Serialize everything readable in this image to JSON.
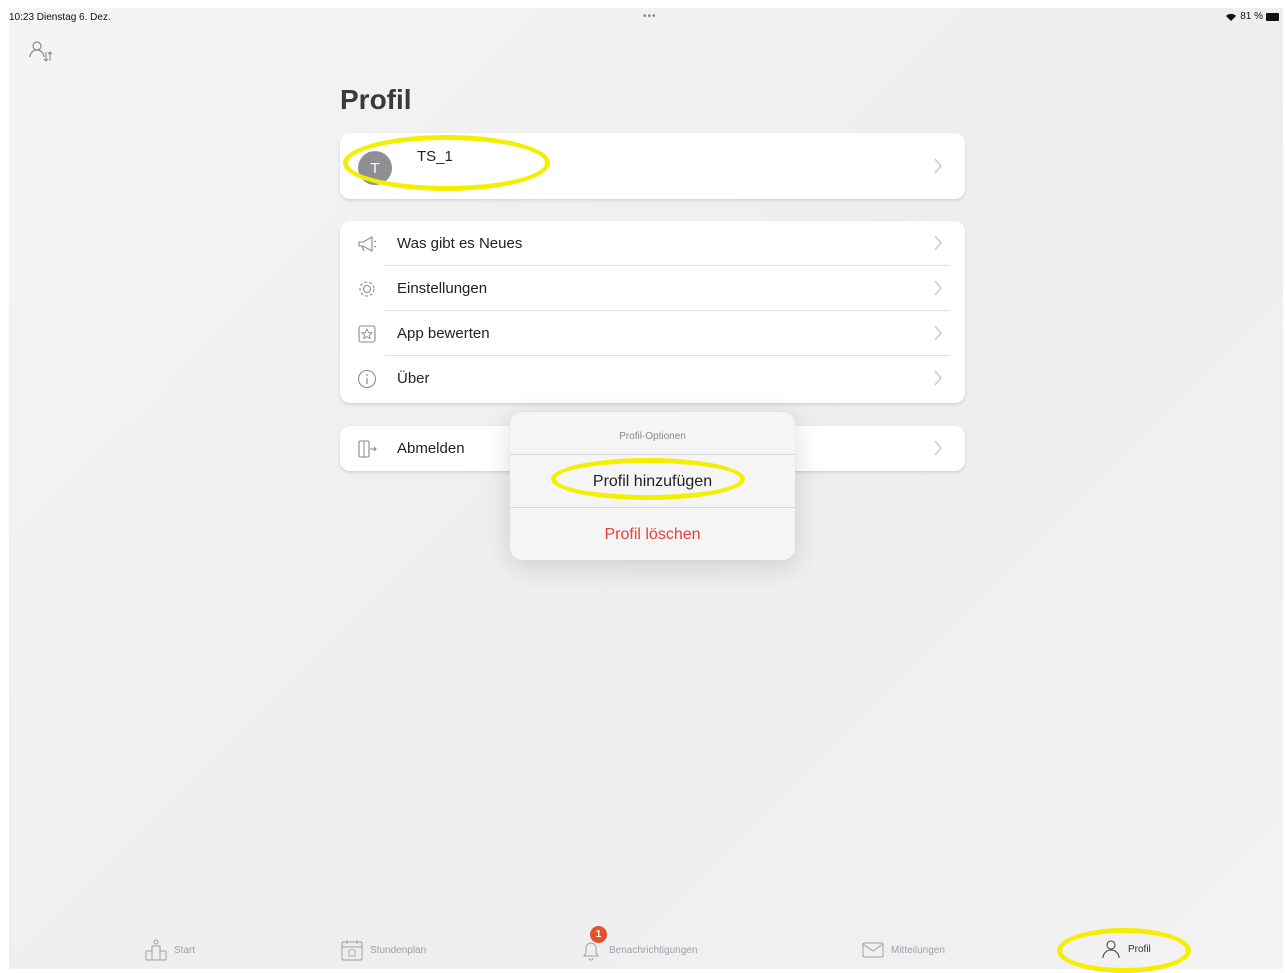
{
  "status_bar": {
    "time_date": "10:23  Dienstag 6. Dez.",
    "dots": "•••",
    "battery": "81 %"
  },
  "page": {
    "title": "Profil"
  },
  "profile_card": {
    "avatar_initial": "T",
    "name": "TS_1"
  },
  "menu": {
    "items": [
      {
        "label": "Was gibt es Neues",
        "icon": "megaphone-icon"
      },
      {
        "label": "Einstellungen",
        "icon": "gear-icon"
      },
      {
        "label": "App bewerten",
        "icon": "star-icon"
      },
      {
        "label": "Über",
        "icon": "info-icon"
      }
    ]
  },
  "logout": {
    "label": "Abmelden",
    "icon": "logout-icon"
  },
  "action_sheet": {
    "title": "Profil-Optionen",
    "add_label": "Profil hinzufügen",
    "delete_label": "Profil löschen"
  },
  "tab_bar": {
    "tabs": [
      {
        "label": "Start",
        "icon": "school-icon"
      },
      {
        "label": "Stundenplan",
        "icon": "calendar-icon"
      },
      {
        "label": "Benachrichtigungen",
        "icon": "bell-icon",
        "badge": "1"
      },
      {
        "label": "Mitteilungen",
        "icon": "mail-icon"
      },
      {
        "label": "Profil",
        "icon": "person-icon"
      }
    ]
  },
  "colors": {
    "highlight": "#f4ee00",
    "destructive": "#e8403a",
    "badge": "#e8502c",
    "avatar": "#8e8e93"
  }
}
